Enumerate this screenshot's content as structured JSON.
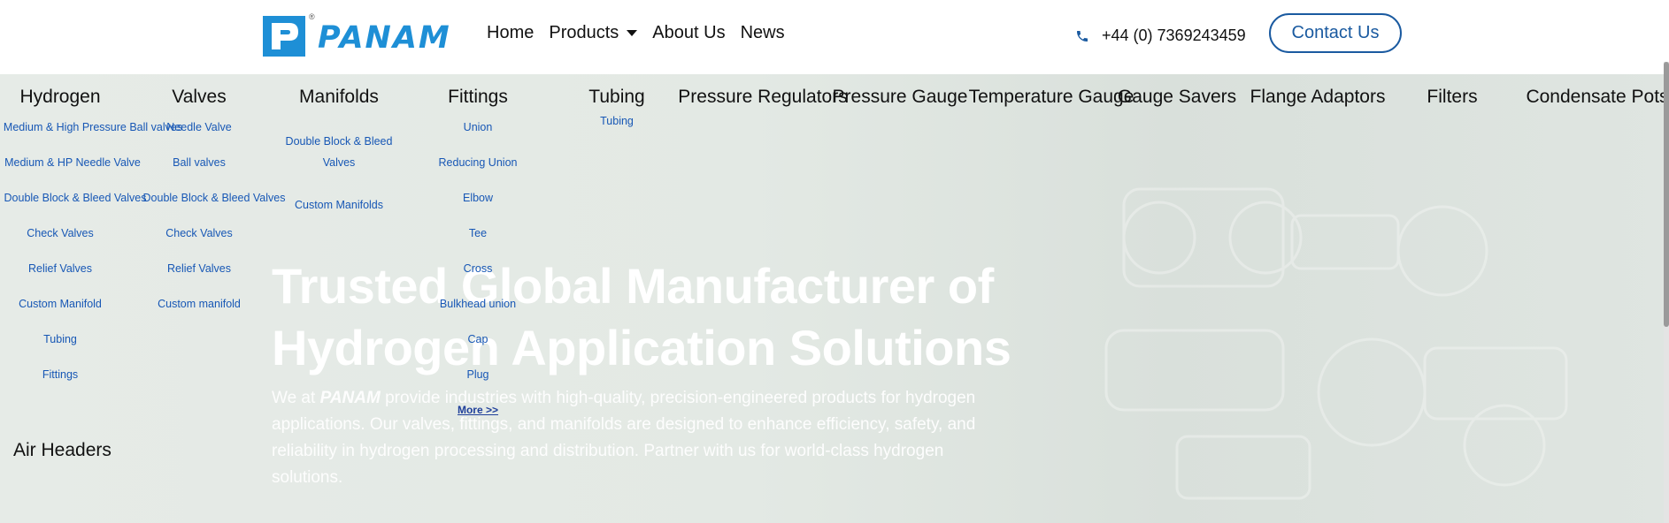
{
  "header": {
    "logo_text": "PANAM",
    "logo_reg": "®",
    "nav": {
      "home": "Home",
      "products": "Products",
      "about": "About Us",
      "news": "News"
    },
    "phone": "+44 (0) 7369243459",
    "contact_label": "Contact Us",
    "colors": {
      "brand": "#1e8fd6",
      "link": "#1757b5",
      "button_border": "#1a5aa0"
    }
  },
  "hero": {
    "title_line1": "Trusted Global Manufacturer of",
    "title_line2": "Hydrogen Application Solutions",
    "body_prefix": "We at ",
    "body_brand": "PANAM",
    "body_rest": " provide industries with high-quality, precision-engineered products for hydrogen applications. Our valves, fittings, and manifolds are designed to enhance efficiency, safety, and reliability in hydrogen processing and distribution. Partner with us for world-class hydrogen solutions."
  },
  "mega_menu": {
    "columns": [
      {
        "heading": "Hydrogen",
        "items": [
          "Medium & High Pressure Ball valves",
          "Medium & HP Needle Valve",
          "Double Block & Bleed Valves",
          "Check Valves",
          "Relief Valves",
          "Custom Manifold",
          "Tubing",
          "Fittings"
        ]
      },
      {
        "heading": "Valves",
        "items": [
          "Needle Valve",
          "Ball valves",
          "Double Block & Bleed Valves",
          "Check Valves",
          "Relief Valves",
          "Custom manifold"
        ]
      },
      {
        "heading": "Manifolds",
        "items": [
          "Double Block & Bleed Valves",
          "Custom Manifolds"
        ]
      },
      {
        "heading": "Fittings",
        "items": [
          "Union",
          "Reducing Union",
          "Elbow",
          "Tee",
          "Cross",
          "Bulkhead union",
          "Cap",
          "Plug"
        ],
        "more": "More >>"
      },
      {
        "heading": "Tubing",
        "items": [
          "Tubing"
        ]
      },
      {
        "heading": "Pressure Regulators",
        "items": []
      },
      {
        "heading": "Pressure Gauge",
        "items": []
      },
      {
        "heading": "Temperature Gauge",
        "items": []
      },
      {
        "heading": "Gauge Savers",
        "items": []
      },
      {
        "heading": "Flange Adaptors",
        "items": []
      },
      {
        "heading": "Filters",
        "items": []
      },
      {
        "heading": "Condensate Pots",
        "items": []
      }
    ],
    "extra_heading": "Air Headers"
  }
}
